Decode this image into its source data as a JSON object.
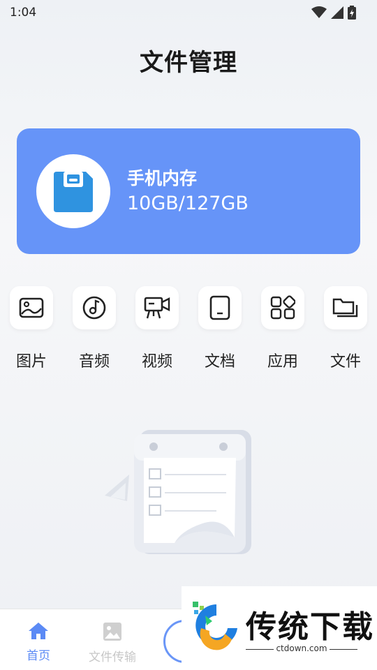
{
  "status_bar": {
    "time": "1:04"
  },
  "header": {
    "title": "文件管理"
  },
  "storage": {
    "label": "手机内存",
    "value": "10GB/127GB"
  },
  "categories": [
    {
      "label": "图片",
      "icon": "image-icon"
    },
    {
      "label": "音频",
      "icon": "music-disc-icon"
    },
    {
      "label": "视频",
      "icon": "video-camera-icon"
    },
    {
      "label": "文档",
      "icon": "document-icon"
    },
    {
      "label": "应用",
      "icon": "apps-grid-icon"
    },
    {
      "label": "文件",
      "icon": "folders-icon"
    }
  ],
  "bottom_nav": {
    "home": "首页",
    "transfer": "文件传输"
  },
  "watermark": {
    "brand": "传统下载",
    "url": "ctdown.com"
  },
  "colors": {
    "accent": "#6694f8",
    "nav_active": "#5b8af5"
  }
}
